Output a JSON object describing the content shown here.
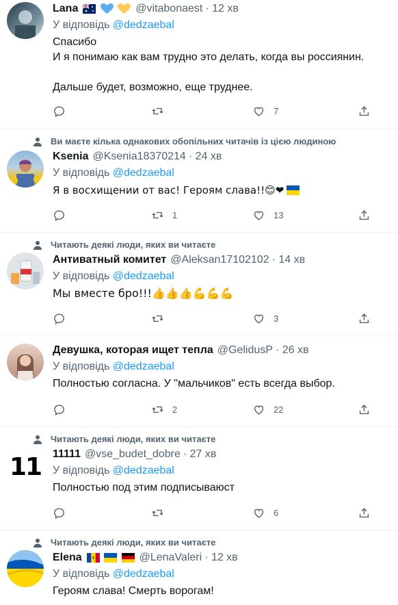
{
  "reply_prefix": "У відповідь",
  "tweets": [
    {
      "name": "Lana",
      "name_extra": "🇦🇺💙💛",
      "handle": "@vitabonaest",
      "time": "12 хв",
      "reply_to": "@dedzaebal",
      "lines": [
        "Спасибо",
        "И я понимаю как вам трудно это делать, когда вы россиянин.",
        "",
        "Дальше будет, возможно, еще труднее."
      ],
      "retweets": "",
      "likes": "7"
    },
    {
      "context": "Ви маєте кілька однакових обопільних читачів із цією людиною",
      "name": "Ksenia",
      "handle": "@Ksenia18370214",
      "time": "24 хв",
      "reply_to": "@dedzaebal",
      "lines": [
        "Я в восхищении от вас! Героям слава!!😊❤"
      ],
      "retweets": "1",
      "likes": "13"
    },
    {
      "context": "Читають деякі люди, яких ви читаєте",
      "name": "Антиватный комитет",
      "handle": "@Aleksan17102102",
      "time": "14 хв",
      "reply_to": "@dedzaebal",
      "lines": [
        "Мы вместе бро!!!👍👍👍💪💪💪"
      ],
      "retweets": "",
      "likes": "3"
    },
    {
      "name": "Девушка, которая ищет тепла",
      "handle": "@GelidusP",
      "time": "26 хв",
      "reply_to": "@dedzaebal",
      "lines": [
        "Полностью согласна. У \"мальчиков\" есть всегда выбор."
      ],
      "retweets": "2",
      "likes": "22"
    },
    {
      "context": "Читають деякі люди, яких ви читаєте",
      "name": "11111",
      "handle": "@vse_budet_dobre",
      "time": "27 хв",
      "reply_to": "@dedzaebal",
      "lines": [
        "Полностью под этим подписываюст"
      ],
      "retweets": "",
      "likes": "6",
      "avatar_text": "11"
    },
    {
      "context": "Читають деякі люди, яких ви читаєте",
      "name": "Elena",
      "handle": "@LenaValeri",
      "time": "12 хв",
      "reply_to": "@dedzaebal",
      "lines": [
        "Героям слава! Смерть ворогам!"
      ]
    }
  ],
  "icons": [
    "person-icon",
    "reply-icon",
    "retweet-icon",
    "like-icon",
    "share-icon"
  ],
  "colors": {
    "link": "#1d9bf0",
    "muted": "#536471",
    "text": "#0f1419",
    "border": "#eff3f4"
  }
}
